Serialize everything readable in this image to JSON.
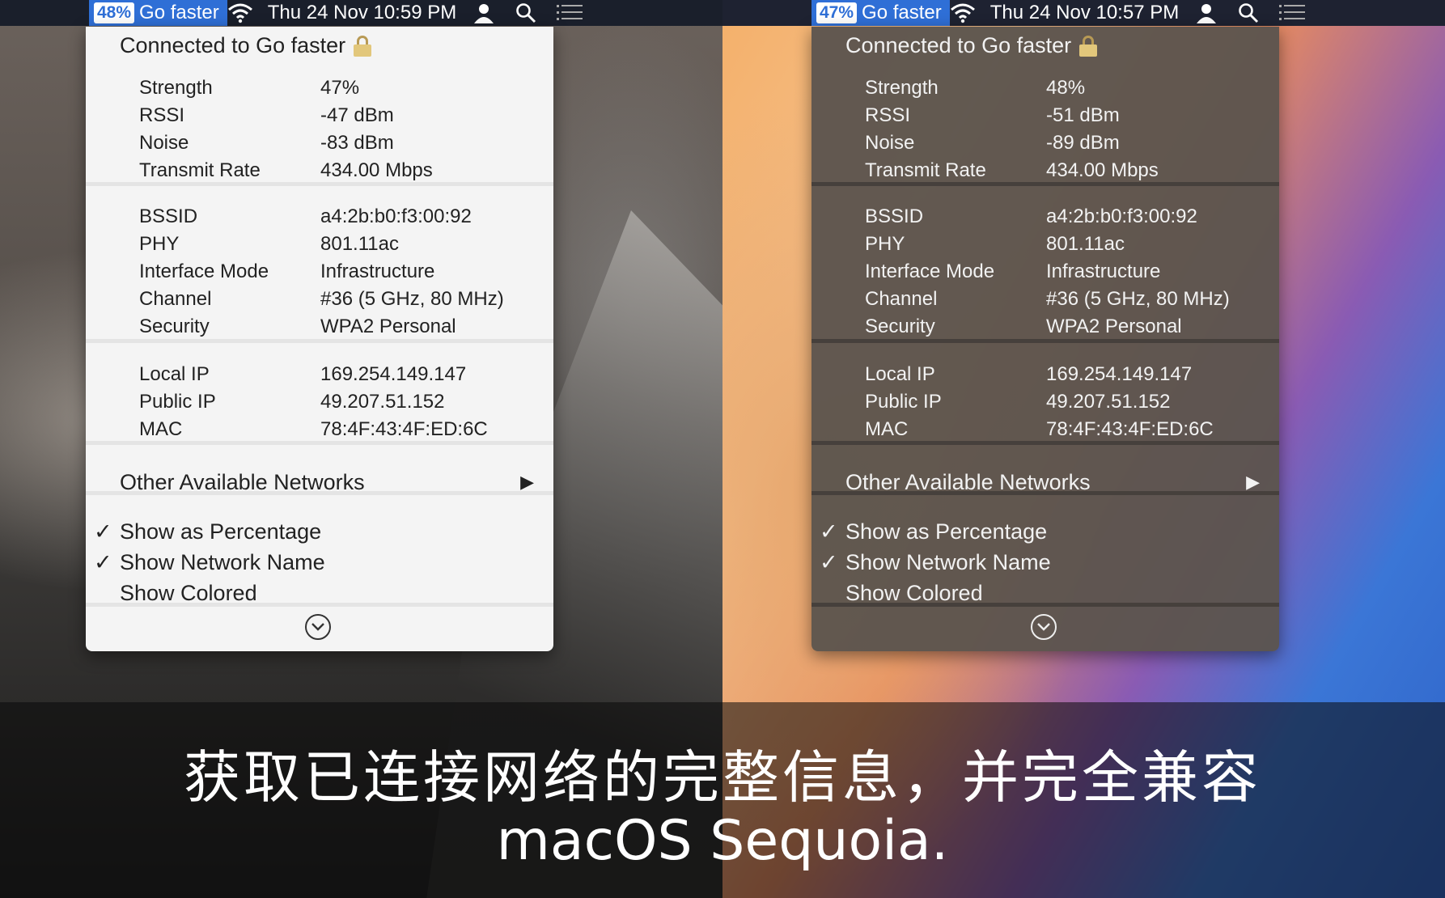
{
  "left": {
    "menubar": {
      "badge": "48%",
      "network": "Go faster",
      "datetime": "Thu 24 Nov  10:59 PM"
    },
    "menu": {
      "header": "Connected to Go faster",
      "signal": [
        {
          "key": "Strength",
          "value": "47%"
        },
        {
          "key": "RSSI",
          "value": "-47 dBm"
        },
        {
          "key": "Noise",
          "value": "-83 dBm"
        },
        {
          "key": "Transmit Rate",
          "value": "434.00 Mbps"
        }
      ],
      "link": [
        {
          "key": "BSSID",
          "value": "a4:2b:b0:f3:00:92"
        },
        {
          "key": "PHY",
          "value": "801.11ac"
        },
        {
          "key": "Interface Mode",
          "value": "Infrastructure"
        },
        {
          "key": "Channel",
          "value": "#36 (5 GHz, 80 MHz)"
        },
        {
          "key": "Security",
          "value": "WPA2 Personal"
        }
      ],
      "addresses": [
        {
          "key": "Local IP",
          "value": "169.254.149.147"
        },
        {
          "key": "Public IP",
          "value": "49.207.51.152"
        },
        {
          "key": "MAC",
          "value": "78:4F:43:4F:ED:6C"
        }
      ],
      "other_networks": "Other Available Networks",
      "options": [
        {
          "label": "Show as Percentage",
          "checked": true
        },
        {
          "label": "Show Network Name",
          "checked": true
        },
        {
          "label": "Show Colored",
          "checked": false
        }
      ]
    }
  },
  "right": {
    "menubar": {
      "badge": "47%",
      "network": "Go faster",
      "datetime": "Thu 24 Nov  10:57 PM"
    },
    "menu": {
      "header": "Connected to Go faster",
      "signal": [
        {
          "key": "Strength",
          "value": "48%"
        },
        {
          "key": "RSSI",
          "value": "-51 dBm"
        },
        {
          "key": "Noise",
          "value": "-89 dBm"
        },
        {
          "key": "Transmit Rate",
          "value": "434.00 Mbps"
        }
      ],
      "link": [
        {
          "key": "BSSID",
          "value": "a4:2b:b0:f3:00:92"
        },
        {
          "key": "PHY",
          "value": "801.11ac"
        },
        {
          "key": "Interface Mode",
          "value": "Infrastructure"
        },
        {
          "key": "Channel",
          "value": "#36 (5 GHz, 80 MHz)"
        },
        {
          "key": "Security",
          "value": "WPA2 Personal"
        }
      ],
      "addresses": [
        {
          "key": "Local IP",
          "value": "169.254.149.147"
        },
        {
          "key": "Public IP",
          "value": "49.207.51.152"
        },
        {
          "key": "MAC",
          "value": "78:4F:43:4F:ED:6C"
        }
      ],
      "other_networks": "Other Available Networks",
      "options": [
        {
          "label": "Show as Percentage",
          "checked": true
        },
        {
          "label": "Show Network Name",
          "checked": true
        },
        {
          "label": "Show Colored",
          "checked": false
        }
      ]
    }
  },
  "icons": {
    "wifi": "wifi-icon",
    "user": "user-icon",
    "search": "search-icon",
    "list": "list-icon",
    "lock": "lock-icon",
    "submenu": "triangle-right-icon",
    "more": "chevron-down-circle-icon",
    "check": "✓"
  },
  "caption": {
    "line1": "获取已连接网络的完整信息，并完全兼容",
    "line2": "macOS Sequoia."
  }
}
